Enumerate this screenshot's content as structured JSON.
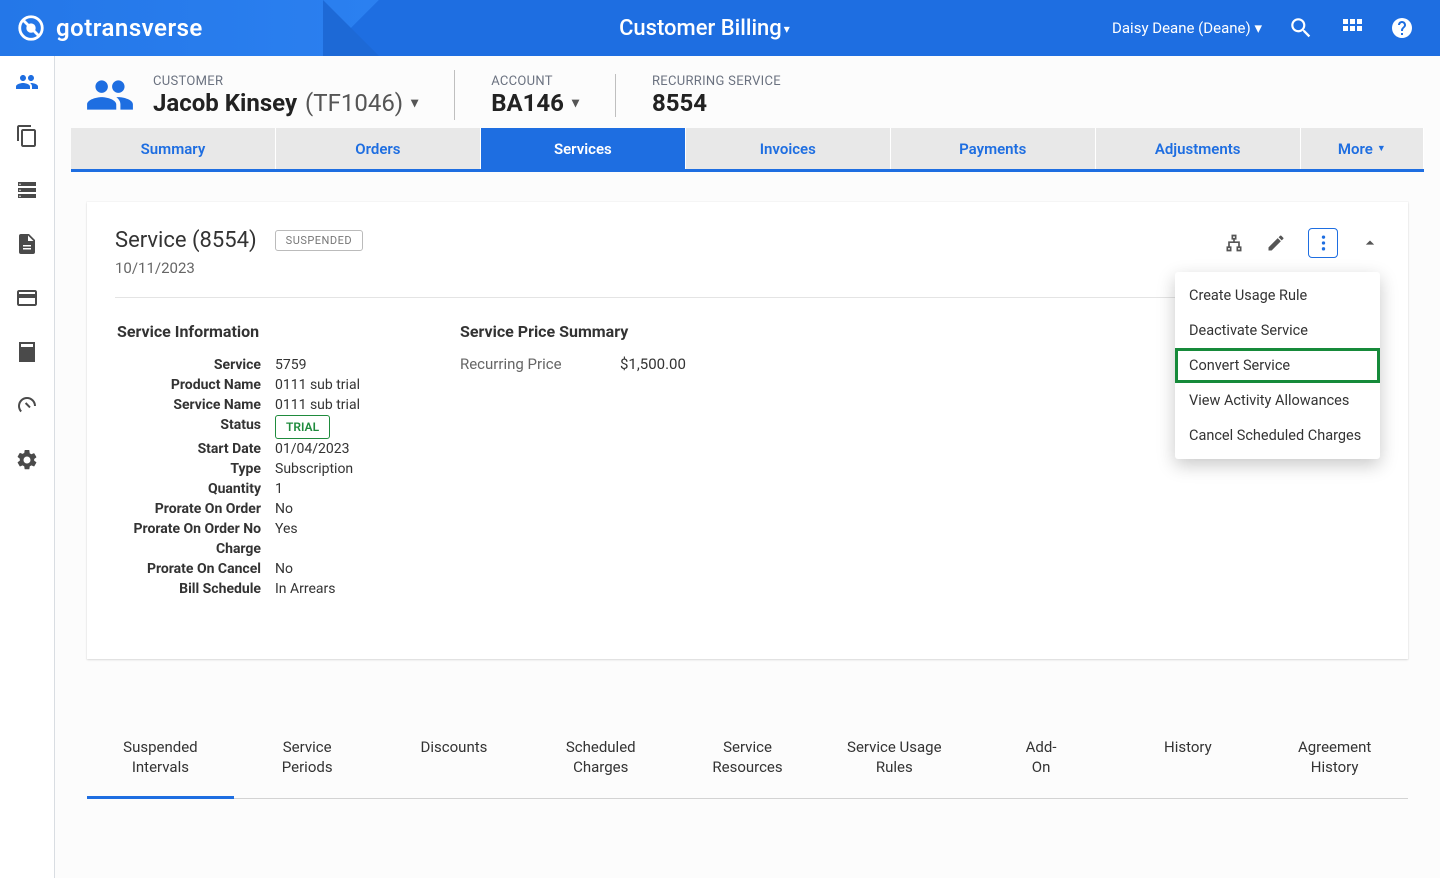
{
  "header": {
    "brand": "gotransverse",
    "center_label": "Customer Billing",
    "user_name": "Daisy Deane (Deane)"
  },
  "breadcrumb": {
    "customer_label": "CUSTOMER",
    "customer_name": "Jacob Kinsey",
    "customer_code": "(TF1046)",
    "account_label": "ACCOUNT",
    "account_value": "BA146",
    "recurring_label": "RECURRING SERVICE",
    "recurring_value": "8554"
  },
  "tabs": [
    "Summary",
    "Orders",
    "Services",
    "Invoices",
    "Payments",
    "Adjustments",
    "More"
  ],
  "tabs_active_index": 2,
  "service": {
    "title": "Service (8554)",
    "badge": "SUSPENDED",
    "date": "10/11/2023",
    "info_heading": "Service Information",
    "price_heading": "Service Price Summary",
    "info": {
      "Service": "5759",
      "Product Name": "0111 sub trial",
      "Service Name": "0111 sub trial",
      "Status": "TRIAL",
      "Start Date": "01/04/2023",
      "Type": "Subscription",
      "Quantity": "1",
      "Prorate On Order": "No",
      "Prorate On Order No Charge": "Yes",
      "Prorate On Cancel": "No",
      "Bill Schedule": "In Arrears"
    },
    "price": {
      "Recurring Price": "$1,500.00"
    }
  },
  "dropdown_items": [
    "Create Usage Rule",
    "Deactivate Service",
    "Convert Service",
    "View Activity Allowances",
    "Cancel Scheduled Charges"
  ],
  "dropdown_highlight_index": 2,
  "subtabs": [
    "Suspended Intervals",
    "Service Periods",
    "Discounts",
    "Scheduled Charges",
    "Service Resources",
    "Service Usage Rules",
    "Add-On",
    "History",
    "Agreement History"
  ],
  "subtabs_active_index": 0
}
